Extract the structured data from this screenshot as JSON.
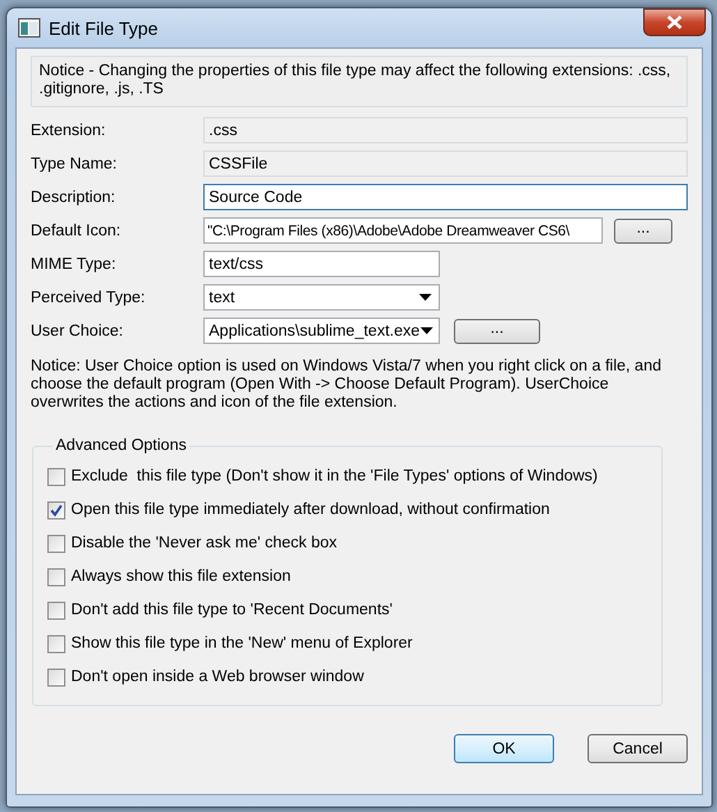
{
  "window": {
    "title": "Edit File Type"
  },
  "notice": "Notice - Changing the properties of this file type may affect the following extensions: .css, .gitignore, .js, .TS",
  "fields": [
    {
      "label": "Extension:",
      "value": ".css",
      "kind": "readonly",
      "focused": false
    },
    {
      "label": "Type Name:",
      "value": "CSSFile",
      "kind": "readonly",
      "focused": false
    },
    {
      "label": "Description:",
      "value": "Source Code",
      "kind": "text",
      "focused": true
    },
    {
      "label": "Default Icon:",
      "value": "\"C:\\Program Files (x86)\\Adobe\\Adobe Dreamweaver CS6\\",
      "kind": "path",
      "focused": false,
      "button": "..."
    },
    {
      "label": "MIME Type:",
      "value": "text/css",
      "kind": "short",
      "focused": false
    },
    {
      "label": "Perceived Type:",
      "value": "text",
      "kind": "dropdown",
      "focused": false
    },
    {
      "label": "User Choice:",
      "value": "Applications\\sublime_text.exe",
      "kind": "dropdown",
      "focused": false,
      "button": "..."
    }
  ],
  "user_choice_notice": "Notice: User Choice option is used on Windows Vista/7 when you right click on a file, and choose the default program (Open With -> Choose Default Program). UserChoice overwrites the actions and icon of the file extension.",
  "advanced_options": {
    "title": "Advanced Options",
    "options": [
      {
        "label": "Exclude  this file type (Don't show it in the 'File Types' options of Windows)",
        "checked": false
      },
      {
        "label": "Open this file type immediately after download, without confirmation",
        "checked": true
      },
      {
        "label": "Disable the 'Never ask me' check box",
        "checked": false
      },
      {
        "label": "Always show this file extension",
        "checked": false
      },
      {
        "label": "Don't add this file type to 'Recent Documents'",
        "checked": false
      },
      {
        "label": "Show this file type in the 'New' menu of Explorer",
        "checked": false
      },
      {
        "label": "Don't open inside a Web browser window",
        "checked": false
      }
    ]
  },
  "buttons": [
    {
      "label": "OK",
      "default": true
    },
    {
      "label": "Cancel",
      "default": false
    }
  ]
}
